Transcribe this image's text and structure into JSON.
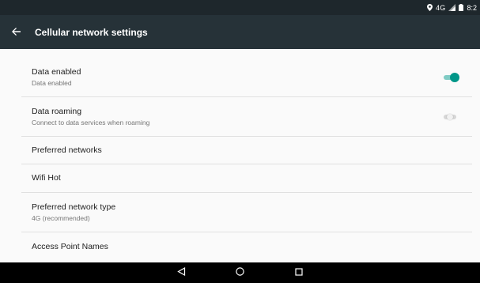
{
  "status_bar": {
    "network": "4G",
    "time": "8:2",
    "icons": [
      "location-icon",
      "signal-icon",
      "battery-icon"
    ]
  },
  "app_bar": {
    "title": "Cellular network settings",
    "back_icon": "arrow-back-icon"
  },
  "settings": [
    {
      "title": "Data enabled",
      "summary": "Data enabled",
      "toggle": true
    },
    {
      "title": "Data roaming",
      "summary": "Connect to data services when roaming",
      "toggle": false
    },
    {
      "title": "Preferred networks",
      "summary": ""
    },
    {
      "title": "Wifi Hot",
      "summary": ""
    },
    {
      "title": "Preferred network type",
      "summary": "4G (recommended)"
    },
    {
      "title": "Access Point Names",
      "summary": ""
    }
  ],
  "nav_bar": {
    "buttons": [
      "back-triangle-icon",
      "home-circle-icon",
      "recents-square-icon"
    ]
  },
  "colors": {
    "status_bar": "#1e272c",
    "app_bar": "#263238",
    "accent": "#009688",
    "background": "#fafafa",
    "divider": "#e0e0e0"
  }
}
